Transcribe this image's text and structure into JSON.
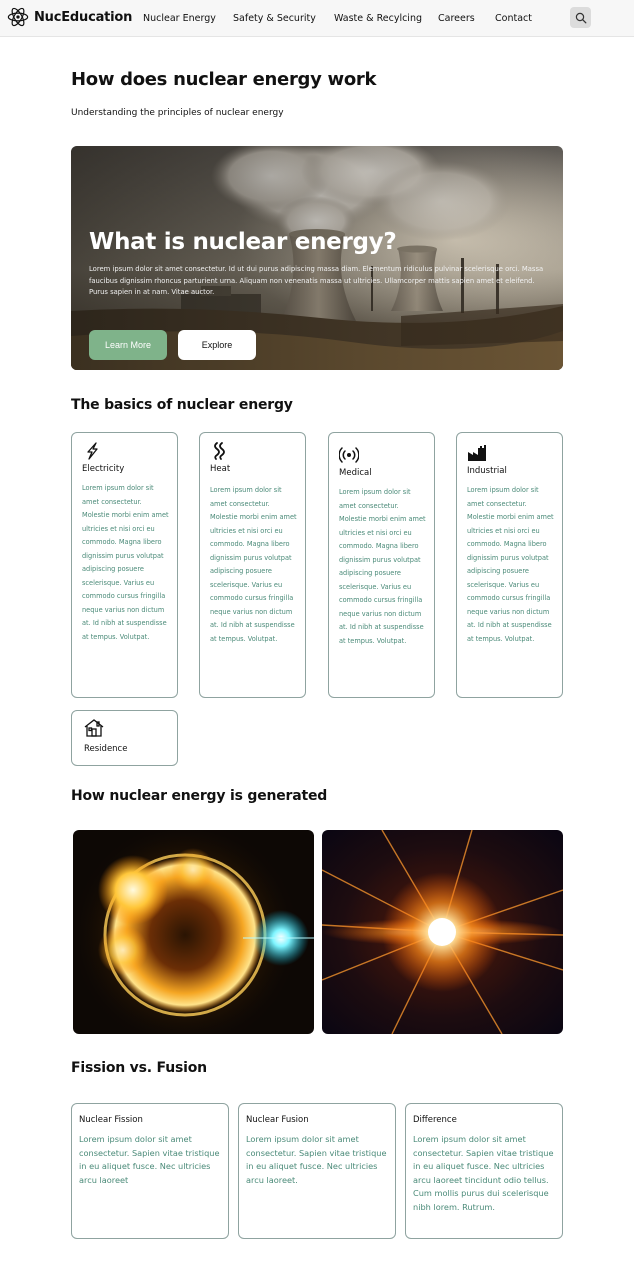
{
  "nav": {
    "brand": "NucEducation",
    "links": [
      "Nuclear Energy",
      "Safety & Security",
      "Waste & Recylcing",
      "Careers",
      "Contact"
    ],
    "search_icon": "search-icon"
  },
  "page": {
    "title": "How does nuclear energy work",
    "subtitle": "Understanding the principles of nuclear energy"
  },
  "hero": {
    "title": "What is nuclear energy?",
    "text": "Lorem ipsum dolor sit amet consectetur. Id ut dui purus adipiscing massa diam. Elementum ridiculus pulvinar scelerisque orci. Massa faucibus dignissim rhoncus parturient urna. Aliquam non venenatis massa ut ultricies. Ullamcorper mattis sapien amet et eleifend. Purus sapien in at nam. Vitae auctor.",
    "learn_more": "Learn More",
    "explore": "Explore"
  },
  "basics": {
    "title": "The basics of nuclear energy",
    "cards": [
      {
        "icon": "lightning-icon",
        "title": "Electricity",
        "text": "Lorem ipsum dolor sit amet consectetur. Molestie morbi enim amet ultricies et nisi orci eu commodo. Magna libero dignissim purus volutpat adipiscing posuere scelerisque. Varius eu commodo cursus fringilla neque varius non dictum at. Id nibh at suspendisse at tempus. Volutpat."
      },
      {
        "icon": "heat-icon",
        "title": "Heat",
        "text": "Lorem ipsum dolor sit amet consectetur. Molestie morbi enim amet ultricies et nisi orci eu commodo. Magna libero dignissim purus volutpat adipiscing posuere scelerisque. Varius eu commodo cursus fringilla neque varius non dictum at. Id nibh at suspendisse at tempus. Volutpat."
      },
      {
        "icon": "radio-waves-icon",
        "title": "Medical",
        "text": "Lorem ipsum dolor sit amet consectetur. Molestie morbi enim amet ultricies et nisi orci eu commodo. Magna libero dignissim purus volutpat adipiscing posuere scelerisque. Varius eu commodo cursus fringilla neque varius non dictum at. Id nibh at suspendisse at tempus. Volutpat."
      },
      {
        "icon": "factory-icon",
        "title": "Industrial",
        "text": "Lorem ipsum dolor sit amet consectetur. Molestie morbi enim amet ultricies et nisi orci eu commodo. Magna libero dignissim purus volutpat adipiscing posuere scelerisque. Varius eu commodo cursus fringilla neque varius non dictum at. Id nibh at suspendisse at tempus. Volutpat."
      }
    ],
    "residence": {
      "icon": "house-icon",
      "title": "Residence"
    }
  },
  "generated": {
    "title": "How nuclear energy is generated"
  },
  "fission": {
    "title": "Fission vs. Fusion",
    "cards": [
      {
        "title": "Nuclear Fission",
        "text": "Lorem ipsum dolor sit amet consectetur. Sapien vitae tristique in eu aliquet fusce. Nec ultricies arcu laoreet"
      },
      {
        "title": "Nuclear Fusion",
        "text": "Lorem ipsum dolor sit amet consectetur. Sapien vitae tristique in eu aliquet fusce. Nec ultricies arcu laoreet."
      },
      {
        "title": "Difference",
        "text": "Lorem ipsum dolor sit amet consectetur. Sapien vitae tristique in eu aliquet fusce. Nec ultricies arcu laoreet tincidunt odio tellus. Cum mollis purus dui scelerisque nibh lorem. Rutrum."
      }
    ]
  },
  "colors": {
    "accent_green": "#7fb38a",
    "body_text_teal": "#4a8a78",
    "card_border": "#8fa3a0"
  }
}
